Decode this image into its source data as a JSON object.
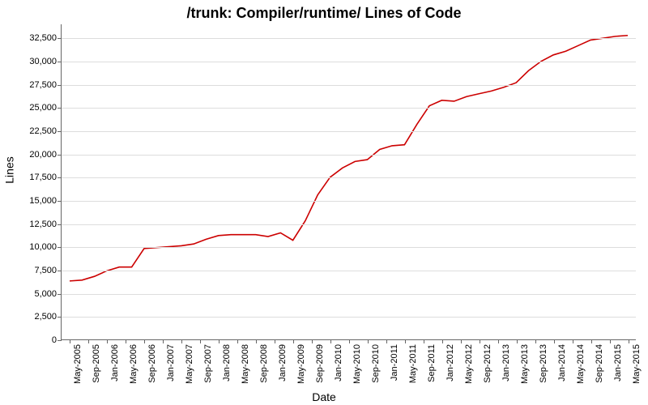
{
  "chart_data": {
    "type": "line",
    "title": "/trunk: Compiler/runtime/ Lines of Code",
    "xlabel": "Date",
    "ylabel": "Lines",
    "ylim": [
      0,
      34000
    ],
    "yticks": [
      0,
      2500,
      5000,
      7500,
      10000,
      12500,
      15000,
      17500,
      20000,
      22500,
      25000,
      27500,
      30000,
      32500
    ],
    "ytick_labels": [
      "0",
      "2,500",
      "5,000",
      "7,500",
      "10,000",
      "12,500",
      "15,000",
      "17,500",
      "20,000",
      "22,500",
      "25,000",
      "27,500",
      "30,000",
      "32,500"
    ],
    "x_categories": [
      "May-2005",
      "Sep-2005",
      "Jan-2006",
      "May-2006",
      "Sep-2006",
      "Jan-2007",
      "May-2007",
      "Sep-2007",
      "Jan-2008",
      "May-2008",
      "Sep-2008",
      "Jan-2009",
      "May-2009",
      "Sep-2009",
      "Jan-2010",
      "May-2010",
      "Sep-2010",
      "Jan-2011",
      "May-2011",
      "Sep-2011",
      "Jan-2012",
      "May-2012",
      "Sep-2012",
      "Jan-2013",
      "May-2013",
      "Sep-2013",
      "Jan-2014",
      "May-2014",
      "Sep-2014",
      "Jan-2015",
      "May-2015"
    ],
    "series": [
      {
        "name": "Lines of Code",
        "color": "#cc0000",
        "values": [
          6300,
          6400,
          6800,
          7400,
          7800,
          7800,
          9800,
          9900,
          10000,
          10100,
          10300,
          10800,
          11200,
          11300,
          11300,
          11300,
          11100,
          11500,
          10700,
          12800,
          15600,
          17500,
          18500,
          19200,
          19400,
          20500,
          20900,
          21000,
          23200,
          25200,
          25800,
          25700,
          26200,
          26500,
          26800,
          27200,
          27700,
          29000,
          30000,
          30700,
          31100,
          31700,
          32300,
          32500,
          32700,
          32800
        ]
      }
    ],
    "x_domain_len": 45
  }
}
